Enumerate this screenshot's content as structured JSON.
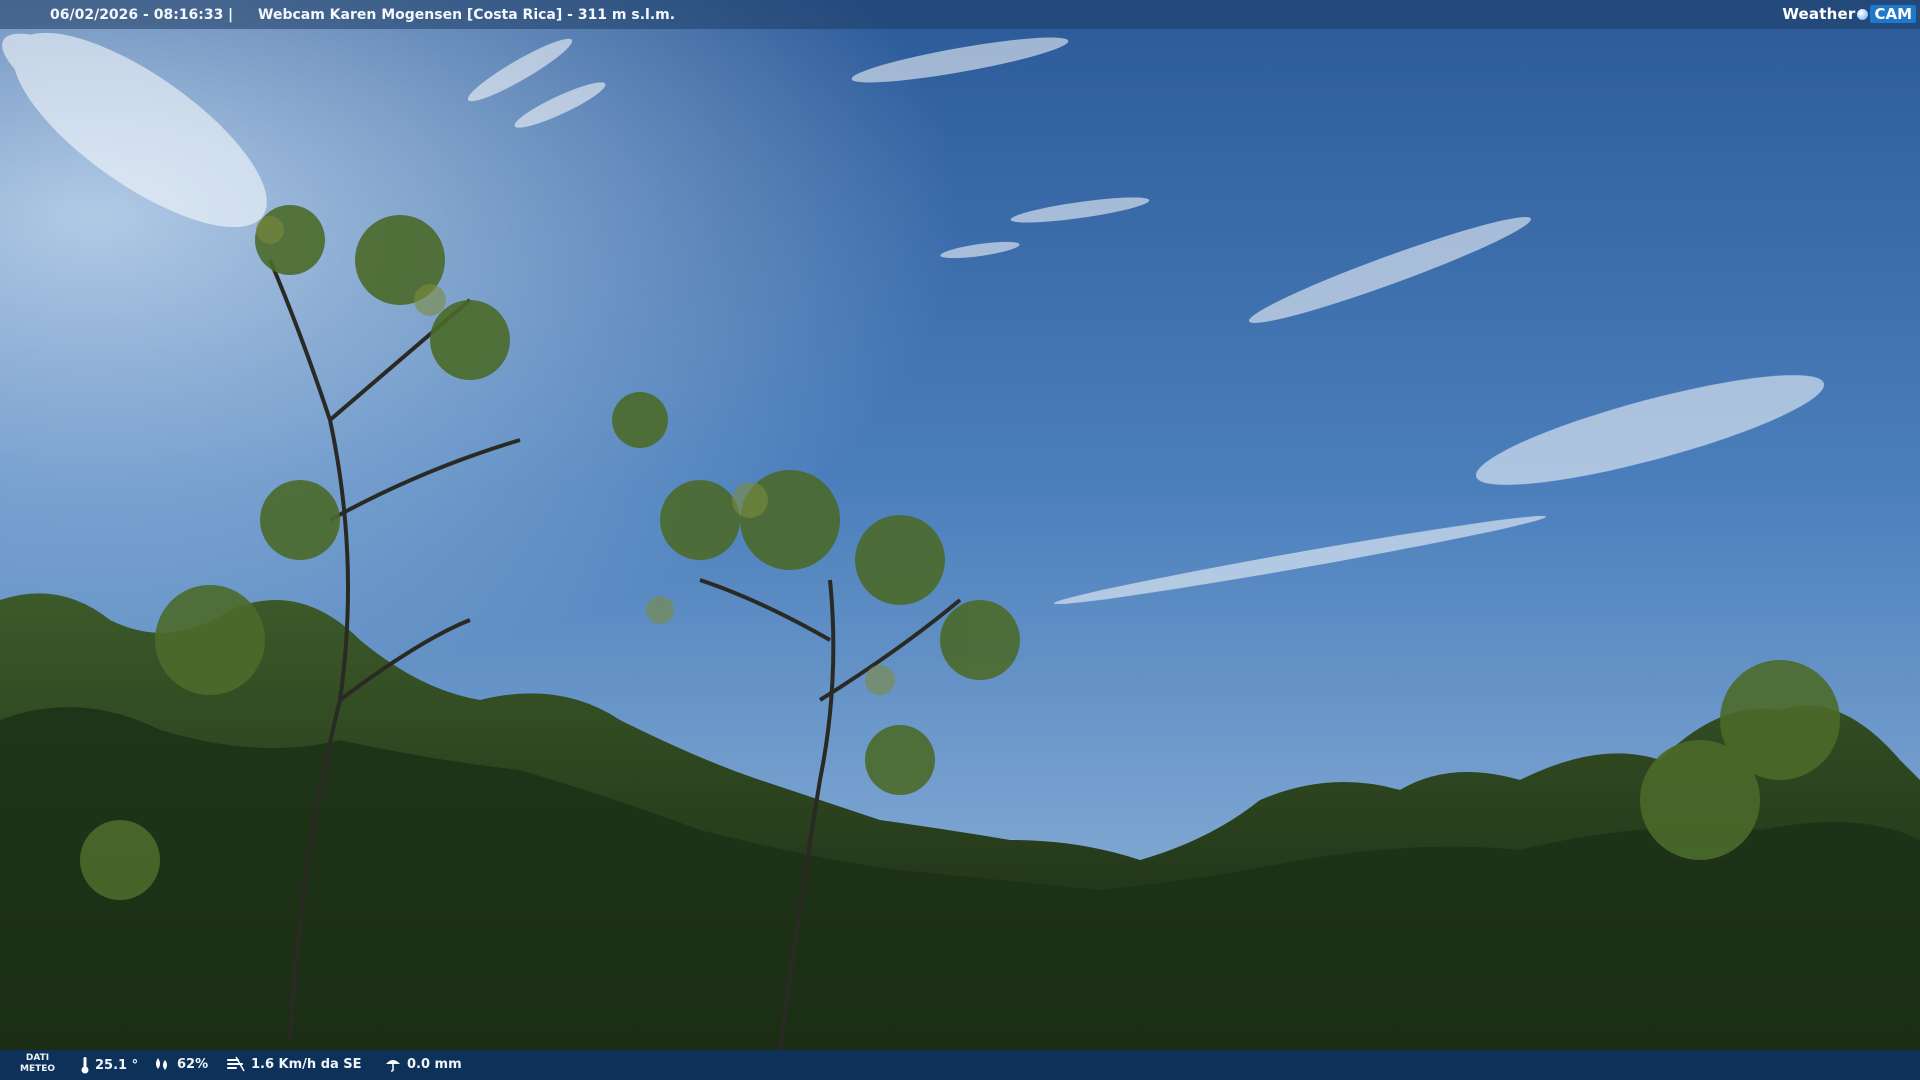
{
  "header": {
    "datetime": "06/02/2026 - 08:16:33",
    "separator": "|",
    "camera_info": "Webcam Karen Mogensen [Costa Rica]  - 311 m s.l.m."
  },
  "logo": {
    "text_weather": "Weather",
    "text_cam": "CAM"
  },
  "footer": {
    "meteo_label_line1": "DATI",
    "meteo_label_line2": "METEO",
    "temperature": "25.1 °",
    "humidity": "62%",
    "wind": "1.6 Km/h da SE",
    "rain": "0.0 mm",
    "icons": [
      "thermometer-icon",
      "humidity-drop-icon",
      "wind-icon",
      "rain-icon"
    ]
  },
  "colors": {
    "sky_top": "#2f5f9e",
    "sky_horizon": "#8fb4d8",
    "foliage": "#1f3a1a",
    "bar": "#0a326e"
  }
}
